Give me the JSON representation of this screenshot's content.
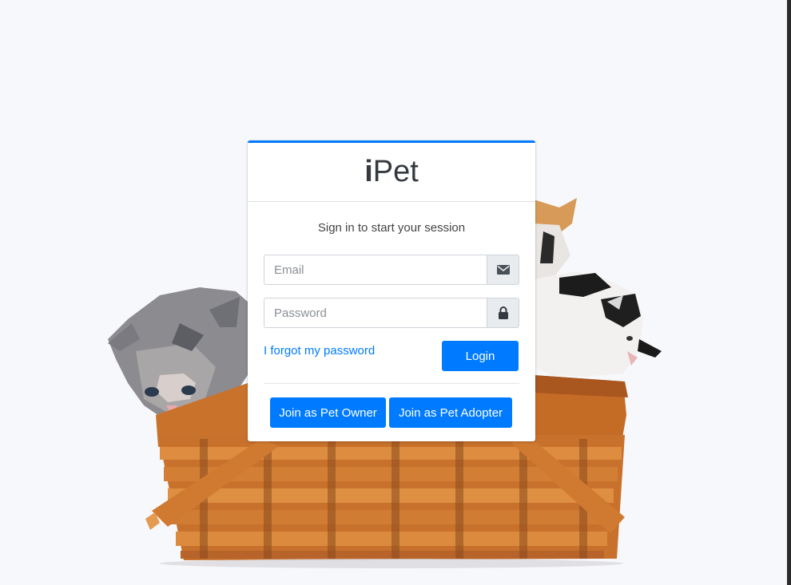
{
  "app": {
    "logo_bold": "i",
    "logo_light": "Pet"
  },
  "login": {
    "message": "Sign in to start your session",
    "email_placeholder": "Email",
    "email_value": "",
    "email_icon": "envelope-icon",
    "password_placeholder": "Password",
    "password_value": "",
    "password_icon": "lock-icon",
    "forgot_label": "I forgot my password",
    "login_label": "Login"
  },
  "register": {
    "owner_label": "Join as Pet Owner",
    "adopter_label": "Join as Pet Adopter"
  },
  "colors": {
    "primary": "#007bff",
    "background": "#f7f8fb",
    "basket": "#c9722b"
  }
}
